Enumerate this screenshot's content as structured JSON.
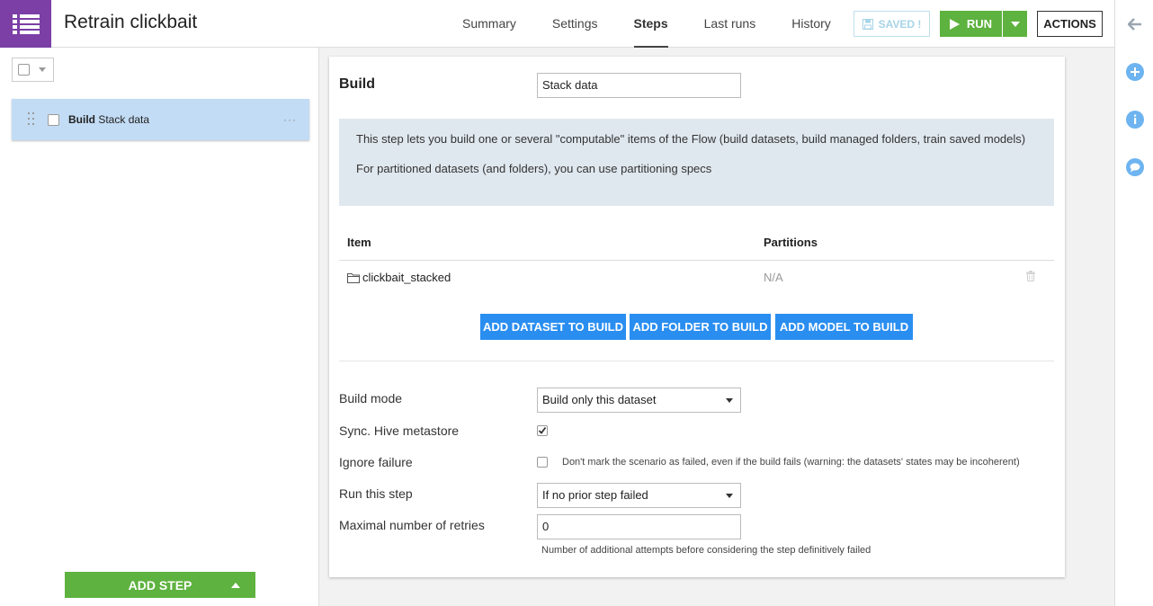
{
  "header": {
    "title": "Retrain clickbait",
    "tabs": [
      {
        "label": "Summary"
      },
      {
        "label": "Settings"
      },
      {
        "label": "Steps"
      },
      {
        "label": "Last runs"
      },
      {
        "label": "History"
      }
    ],
    "active_tab": "Steps",
    "saved_label": "SAVED !",
    "run_label": "RUN",
    "actions_label": "ACTIONS"
  },
  "steps_panel": {
    "items": [
      {
        "type": "Build",
        "name": "Stack data"
      }
    ],
    "add_step_label": "ADD STEP"
  },
  "step": {
    "title": "Build",
    "name_value": "Stack data",
    "info_line1": "This step lets you build one or several \"computable\" items of the Flow (build datasets, build managed folders, train saved models)",
    "info_line2": "For partitioned datasets (and folders), you can use partitioning specs",
    "table": {
      "columns": [
        "Item",
        "Partitions"
      ],
      "rows": [
        {
          "item": "clickbait_stacked",
          "partitions": "N/A"
        }
      ]
    },
    "add_dataset_label": "ADD DATASET TO BUILD",
    "add_folder_label": "ADD FOLDER TO BUILD",
    "add_model_label": "ADD MODEL TO BUILD",
    "build_mode_label": "Build mode",
    "build_mode_value": "Build only this dataset",
    "sync_hive_label": "Sync. Hive metastore",
    "sync_hive_checked": true,
    "ignore_failure_label": "Ignore failure",
    "ignore_failure_checked": false,
    "ignore_failure_help": "Don't mark the scenario as failed, even if the build fails (warning: the datasets' states may be incoherent)",
    "run_this_step_label": "Run this step",
    "run_this_step_value": "If no prior step failed",
    "max_retries_label": "Maximal number of retries",
    "max_retries_value": "0",
    "max_retries_help": "Number of additional attempts before considering the step definitively failed"
  },
  "colors": {
    "brand": "#7b3fa6",
    "run_green": "#5eb23f",
    "primary_blue": "#2a8ef0",
    "selected_step": "#c3dcf5",
    "info_box": "#e0e8ef"
  }
}
